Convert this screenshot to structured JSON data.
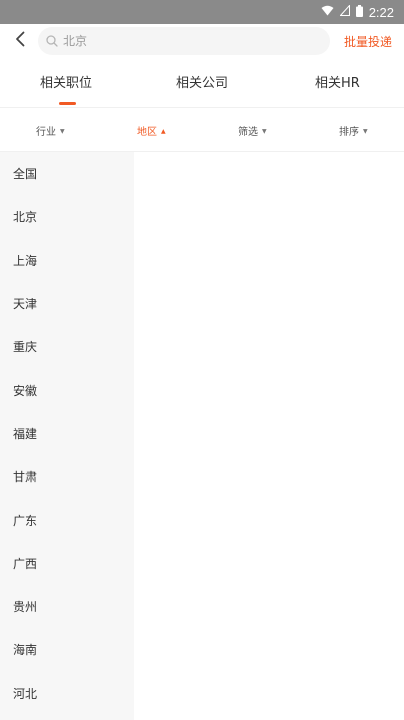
{
  "status_bar": {
    "time": "2:22"
  },
  "search": {
    "placeholder": "北京",
    "batch_label": "批量投递"
  },
  "tabs": [
    {
      "label": "相关职位",
      "active": true
    },
    {
      "label": "相关公司",
      "active": false
    },
    {
      "label": "相关HR",
      "active": false
    }
  ],
  "filters": [
    {
      "label": "行业",
      "active": false
    },
    {
      "label": "地区",
      "active": true
    },
    {
      "label": "筛选",
      "active": false
    },
    {
      "label": "排序",
      "active": false
    }
  ],
  "regions": [
    "全国",
    "北京",
    "上海",
    "天津",
    "重庆",
    "安徽",
    "福建",
    "甘肃",
    "广东",
    "广西",
    "贵州",
    "海南",
    "河北"
  ],
  "colors": {
    "accent": "#f15a24",
    "status_bar": "#8a8a8a",
    "list_bg": "#f7f7f7"
  }
}
